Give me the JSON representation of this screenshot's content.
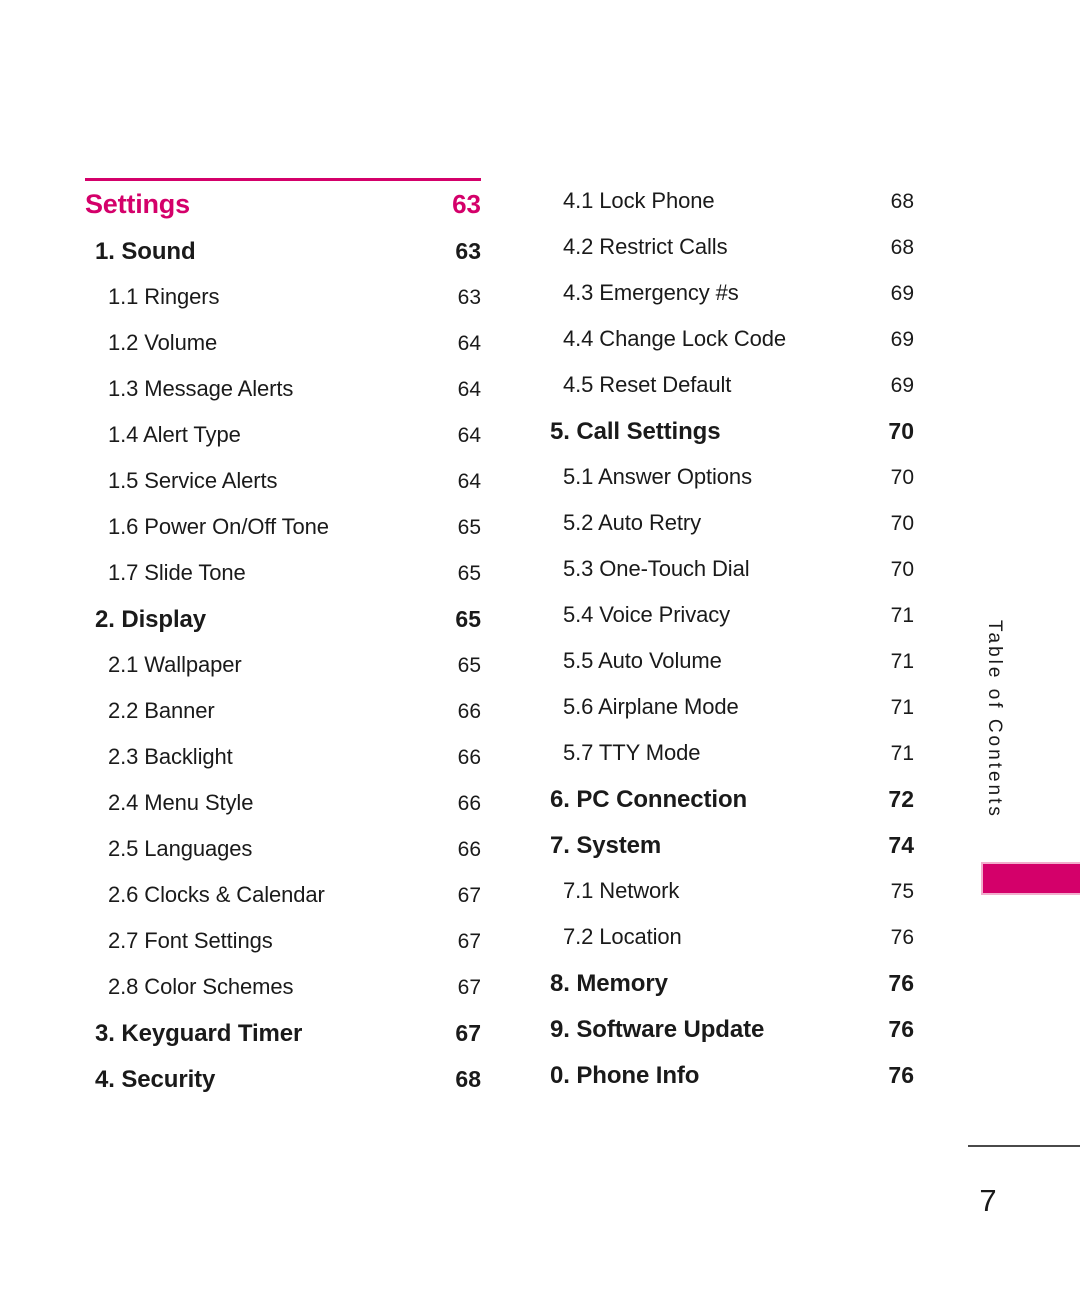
{
  "document": {
    "side_tab_label": "Table of Contents",
    "footer_page_number": "7",
    "accent_color": "#d4006a",
    "accent_light_color": "#f2aecd",
    "text_color": "#1a1a1a"
  },
  "section_header": {
    "title": "Settings",
    "page": "63"
  },
  "columns": {
    "left": [
      {
        "level": 1,
        "label": "1. Sound",
        "page": "63"
      },
      {
        "level": 2,
        "label": "1.1 Ringers",
        "page": "63"
      },
      {
        "level": 2,
        "label": "1.2 Volume",
        "page": "64"
      },
      {
        "level": 2,
        "label": "1.3 Message Alerts",
        "page": "64"
      },
      {
        "level": 2,
        "label": "1.4 Alert Type",
        "page": "64"
      },
      {
        "level": 2,
        "label": "1.5 Service Alerts",
        "page": "64"
      },
      {
        "level": 2,
        "label": "1.6 Power On/Off Tone",
        "page": "65"
      },
      {
        "level": 2,
        "label": "1.7 Slide Tone",
        "page": "65"
      },
      {
        "level": 1,
        "label": "2. Display",
        "page": "65"
      },
      {
        "level": 2,
        "label": "2.1 Wallpaper",
        "page": "65"
      },
      {
        "level": 2,
        "label": "2.2 Banner",
        "page": "66"
      },
      {
        "level": 2,
        "label": "2.3 Backlight",
        "page": "66"
      },
      {
        "level": 2,
        "label": "2.4 Menu Style",
        "page": "66"
      },
      {
        "level": 2,
        "label": "2.5 Languages",
        "page": "66"
      },
      {
        "level": 2,
        "label": "2.6 Clocks & Calendar",
        "page": "67"
      },
      {
        "level": 2,
        "label": "2.7 Font Settings",
        "page": "67"
      },
      {
        "level": 2,
        "label": "2.8 Color Schemes",
        "page": "67"
      },
      {
        "level": 1,
        "label": "3. Keyguard Timer",
        "page": "67"
      },
      {
        "level": 1,
        "label": "4. Security",
        "page": "68"
      }
    ],
    "right": [
      {
        "level": 2,
        "label": "4.1 Lock Phone",
        "page": "68"
      },
      {
        "level": 2,
        "label": "4.2 Restrict Calls",
        "page": "68"
      },
      {
        "level": 2,
        "label": "4.3 Emergency #s",
        "page": "69"
      },
      {
        "level": 2,
        "label": "4.4 Change Lock Code",
        "page": "69"
      },
      {
        "level": 2,
        "label": "4.5 Reset Default",
        "page": "69"
      },
      {
        "level": 1,
        "label": "5. Call Settings",
        "page": "70"
      },
      {
        "level": 2,
        "label": "5.1 Answer Options",
        "page": "70"
      },
      {
        "level": 2,
        "label": "5.2 Auto Retry",
        "page": "70"
      },
      {
        "level": 2,
        "label": "5.3 One-Touch Dial",
        "page": "70"
      },
      {
        "level": 2,
        "label": "5.4 Voice Privacy",
        "page": "71"
      },
      {
        "level": 2,
        "label": "5.5 Auto Volume",
        "page": "71"
      },
      {
        "level": 2,
        "label": "5.6 Airplane Mode",
        "page": "71"
      },
      {
        "level": 2,
        "label": "5.7 TTY Mode",
        "page": "71"
      },
      {
        "level": 1,
        "label": "6. PC Connection",
        "page": "72"
      },
      {
        "level": 1,
        "label": "7. System",
        "page": "74"
      },
      {
        "level": 2,
        "label": "7.1 Network",
        "page": "75"
      },
      {
        "level": 2,
        "label": "7.2 Location",
        "page": "76"
      },
      {
        "level": 1,
        "label": "8. Memory",
        "page": "76"
      },
      {
        "level": 1,
        "label": "9. Software Update",
        "page": "76"
      },
      {
        "level": 1,
        "label": "0. Phone Info",
        "page": "76"
      }
    ]
  }
}
